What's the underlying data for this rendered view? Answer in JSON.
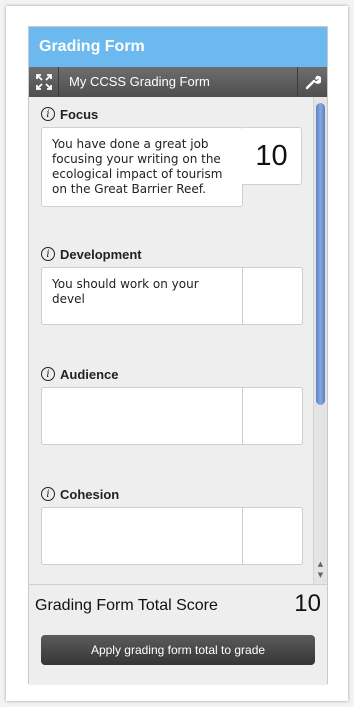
{
  "header": {
    "title": "Grading Form"
  },
  "toolbar": {
    "expand_icon": "expand-icon",
    "title": "My CCSS Grading Form",
    "settings_icon": "wrench-icon"
  },
  "sections": [
    {
      "title": "Focus",
      "comment": "You have done a great job focusing your writing on the ecological impact of tourism on the Great Barrier Reef.",
      "score": "10"
    },
    {
      "title": "Development",
      "comment": "You should work on your devel",
      "score": ""
    },
    {
      "title": "Audience",
      "comment": "",
      "score": ""
    },
    {
      "title": "Cohesion",
      "comment": "",
      "score": ""
    }
  ],
  "footer": {
    "total_label": "Grading Form Total Score",
    "total_value": "10",
    "apply_button": "Apply grading form total to grade"
  },
  "colors": {
    "header_bg": "#6bb9ee",
    "toolbar_bg": "#5a5a5a",
    "scroll_thumb": "#6f93d0"
  }
}
